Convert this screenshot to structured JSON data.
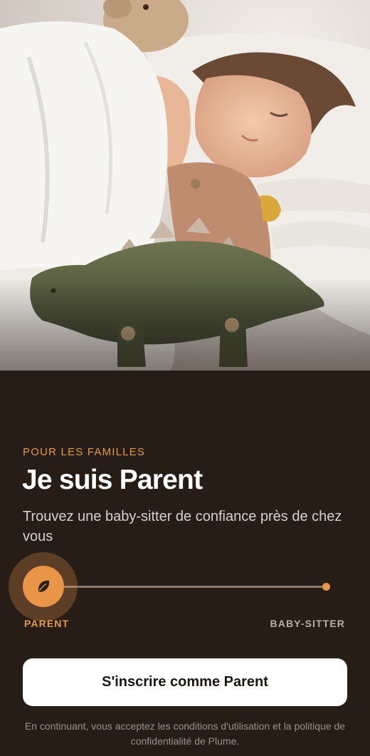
{
  "hero": {
    "image_alt": "Enfant endormi avec une peluche dinosaure"
  },
  "intro": {
    "eyebrow": "POUR LES FAMILLES",
    "title": "Je suis Parent",
    "subtitle": "Trouvez une baby-sitter de confiance près de chez vous"
  },
  "role_switch": {
    "selected": "PARENT",
    "left_label": "PARENT",
    "right_label": "BABY-SITTER",
    "knob_icon": "leaf-icon",
    "position": 0
  },
  "cta": {
    "label": "S'inscrire comme Parent"
  },
  "legal": {
    "text": "En continuant, vous acceptez les conditions d'utilisation et la politique de confidentialité de Plume."
  },
  "colors": {
    "background": "#261d17",
    "accent": "#e8954a",
    "text_primary": "#ffffff",
    "text_secondary": "#d7d0ca",
    "text_muted": "#9a918a",
    "button_bg": "#ffffff"
  }
}
